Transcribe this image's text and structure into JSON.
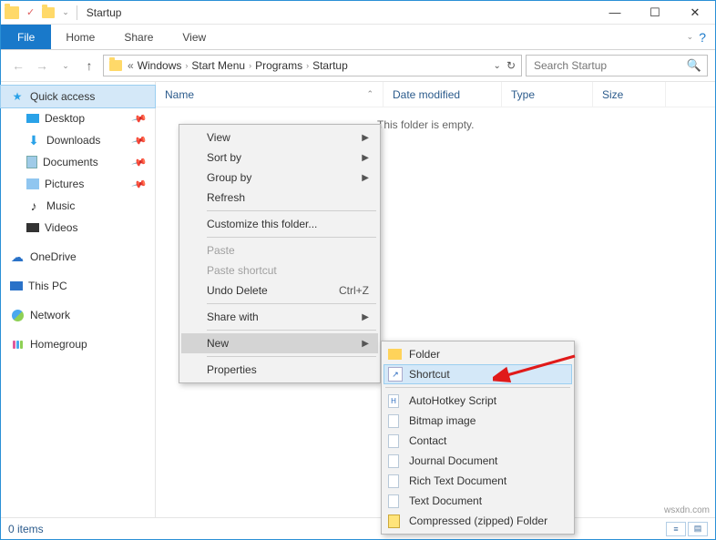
{
  "window": {
    "title": "Startup"
  },
  "qat": {
    "check_glyph": "✓"
  },
  "winbtns": {
    "min": "—",
    "max": "☐",
    "close": "✕"
  },
  "ribbon": {
    "file": "File",
    "tabs": [
      "Home",
      "Share",
      "View"
    ],
    "help_glyph": "?",
    "chev": "⌄"
  },
  "nav": {
    "back": "←",
    "fwd": "→",
    "down": "⌄",
    "up": "↑"
  },
  "address": {
    "segments": [
      "Windows",
      "Start Menu",
      "Programs",
      "Startup"
    ],
    "chev": "›",
    "dbl": "«",
    "refresh": "↻",
    "dropdown": "⌄"
  },
  "search": {
    "placeholder": "Search Startup",
    "icon": "🔍"
  },
  "sidebar": {
    "quick": "Quick access",
    "items": [
      {
        "label": "Desktop",
        "pin": true
      },
      {
        "label": "Downloads",
        "pin": true
      },
      {
        "label": "Documents",
        "pin": true
      },
      {
        "label": "Pictures",
        "pin": true
      },
      {
        "label": "Music",
        "pin": false
      },
      {
        "label": "Videos",
        "pin": false
      }
    ],
    "onedrive": "OneDrive",
    "thispc": "This PC",
    "network": "Network",
    "homegroup": "Homegroup"
  },
  "columns": {
    "name": "Name",
    "date": "Date modified",
    "type": "Type",
    "size": "Size",
    "sort_glyph": "⌃"
  },
  "content": {
    "empty": "This folder is empty."
  },
  "ctxmenu": {
    "view": "View",
    "sortby": "Sort by",
    "groupby": "Group by",
    "refresh": "Refresh",
    "customize": "Customize this folder...",
    "paste": "Paste",
    "pasteshortcut": "Paste shortcut",
    "undodelete": "Undo Delete",
    "undodelete_sc": "Ctrl+Z",
    "sharewith": "Share with",
    "new": "New",
    "properties": "Properties"
  },
  "newmenu": {
    "folder": "Folder",
    "shortcut": "Shortcut",
    "ahk": "AutoHotkey Script",
    "bmp": "Bitmap image",
    "contact": "Contact",
    "journal": "Journal Document",
    "rtf": "Rich Text Document",
    "txt": "Text Document",
    "zip": "Compressed (zipped) Folder"
  },
  "status": {
    "count": "0 items"
  },
  "watermark": "wsxdn.com",
  "pin_glyph": "📌",
  "submenu_arrow": "▶"
}
